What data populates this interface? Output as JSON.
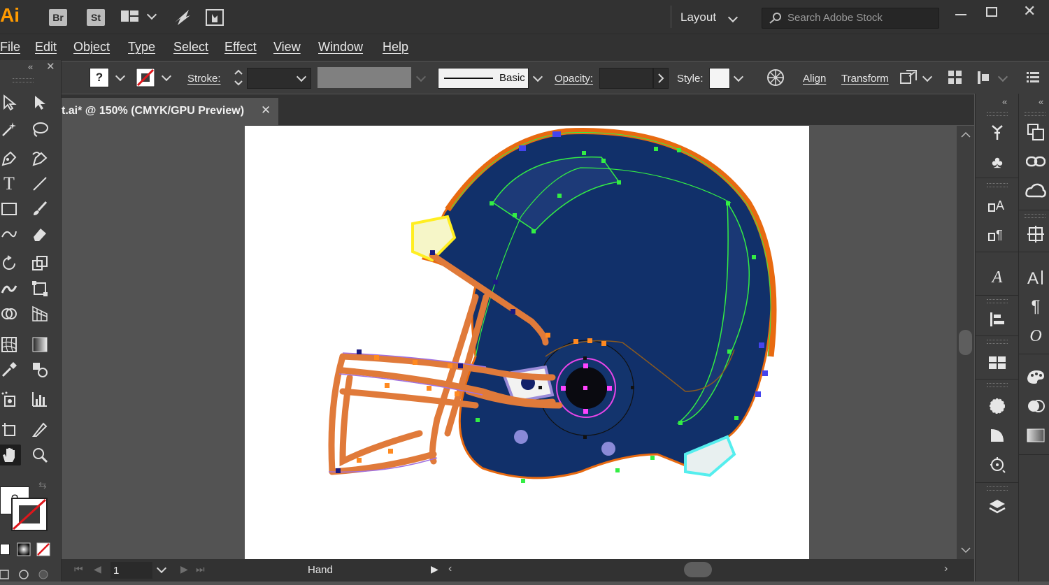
{
  "app": {
    "logo": "Ai",
    "bridge_label": "Br",
    "stock_label": "St"
  },
  "workspace": {
    "label": "Layout"
  },
  "search": {
    "placeholder": "Search Adobe Stock"
  },
  "menu": [
    "File",
    "Edit",
    "Object",
    "Type",
    "Select",
    "Effect",
    "View",
    "Window",
    "Help"
  ],
  "control_bar": {
    "fill_label": "?",
    "stroke_label": "Stroke:",
    "brush_label": "Basic",
    "opacity_label": "Opacity:",
    "style_label": "Style:",
    "align_label": "Align",
    "transform_label": "Transform"
  },
  "document": {
    "tab_title": "t.ai* @ 150% (CMYK/GPU Preview)"
  },
  "tools": {
    "fill_stroke_label": "?"
  },
  "status": {
    "page": "1",
    "tool": "Hand"
  },
  "colors": {
    "helmet_shell": "#11306a",
    "helmet_stripe": "#e86a10",
    "facemask": "#e07a3a",
    "ai_orange": "#ff9a00",
    "anchor_green": "#33ee44"
  }
}
